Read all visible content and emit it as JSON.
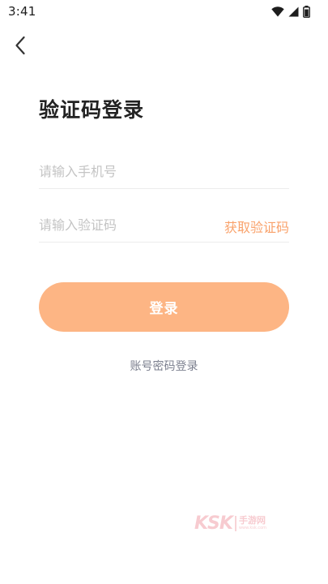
{
  "status_bar": {
    "time": "3:41"
  },
  "header": {
    "back_icon": "chevron-left-icon"
  },
  "title": "验证码登录",
  "phone_field": {
    "placeholder": "请输入手机号",
    "value": ""
  },
  "code_field": {
    "placeholder": "请输入验证码",
    "value": "",
    "get_code_label": "获取验证码"
  },
  "login_button": {
    "label": "登录"
  },
  "switch_link": {
    "label": "账号密码登录"
  },
  "watermark": {
    "logo": "KSK",
    "text": "手游网",
    "sub": "www.ksk.com"
  },
  "colors": {
    "accent": "#f9a26b",
    "button": "#fdb584",
    "placeholder": "#c4c4c4",
    "link_gray": "#7b7f8e"
  }
}
